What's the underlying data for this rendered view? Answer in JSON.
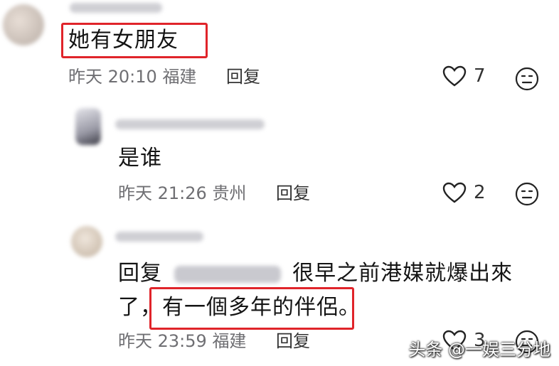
{
  "comments": [
    {
      "text": "她有女朋友",
      "time": "昨天 20:10",
      "location": "福建",
      "reply_label": "回复",
      "likes": "7"
    },
    {
      "text": "是谁",
      "time": "昨天 21:26",
      "location": "贵州",
      "reply_label": "回复",
      "likes": "2"
    },
    {
      "reply_prefix": "回复",
      "text_line1": "很早之前港媒就爆出來",
      "text_line2_a": "了，",
      "text_line2_b": "有一個多年的伴侶。",
      "time": "昨天 23:59",
      "location": "福建",
      "reply_label": "回复",
      "likes": "3"
    }
  ],
  "watermark": "头条 @一娱三分地",
  "colors": {
    "highlight_box": "#e0242a",
    "meta_text": "#6f6f73"
  },
  "icons": [
    "heart-icon",
    "emoji-icon"
  ]
}
